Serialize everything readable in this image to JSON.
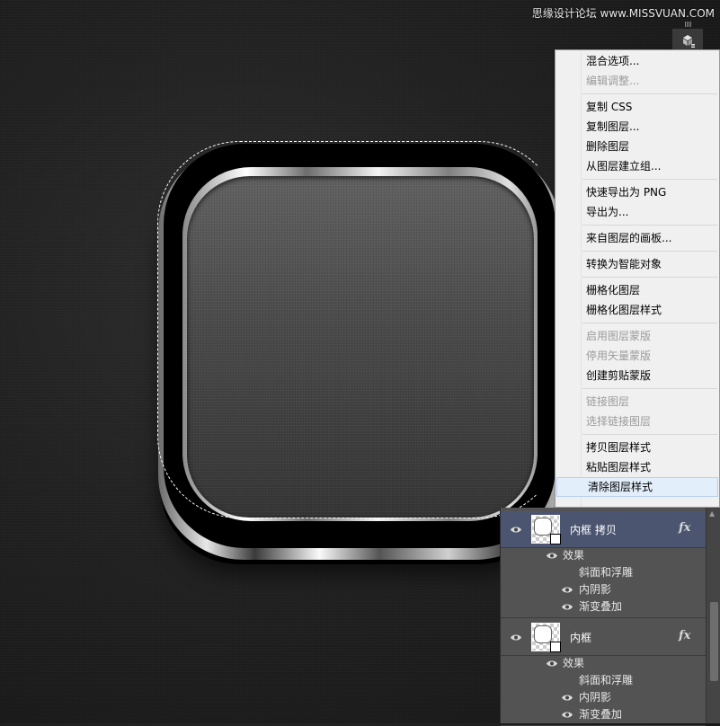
{
  "watermark": "思缘设计论坛 www.MISSVUAN.COM",
  "menu": {
    "groups": [
      [
        {
          "label": "混合选项...",
          "enabled": true
        },
        {
          "label": "编辑调整...",
          "enabled": false
        }
      ],
      [
        {
          "label": "复制 CSS",
          "enabled": true
        },
        {
          "label": "复制图层...",
          "enabled": true
        },
        {
          "label": "删除图层",
          "enabled": true
        },
        {
          "label": "从图层建立组...",
          "enabled": true
        }
      ],
      [
        {
          "label": "快速导出为 PNG",
          "enabled": true
        },
        {
          "label": "导出为...",
          "enabled": true
        }
      ],
      [
        {
          "label": "来自图层的画板...",
          "enabled": true
        }
      ],
      [
        {
          "label": "转换为智能对象",
          "enabled": true
        }
      ],
      [
        {
          "label": "栅格化图层",
          "enabled": true
        },
        {
          "label": "栅格化图层样式",
          "enabled": true
        }
      ],
      [
        {
          "label": "启用图层蒙版",
          "enabled": false
        },
        {
          "label": "停用矢量蒙版",
          "enabled": false
        },
        {
          "label": "创建剪贴蒙版",
          "enabled": true
        }
      ],
      [
        {
          "label": "链接图层",
          "enabled": false
        },
        {
          "label": "选择链接图层",
          "enabled": false
        }
      ],
      [
        {
          "label": "拷贝图层样式",
          "enabled": true
        },
        {
          "label": "粘贴图层样式",
          "enabled": true
        },
        {
          "label": "清除图层样式",
          "enabled": true,
          "hover": true
        }
      ]
    ]
  },
  "layers": [
    {
      "name": "内框 拷贝",
      "selected": true,
      "fx": "fx",
      "effects_label": "效果",
      "effects": [
        "斜面和浮雕",
        "内阴影",
        "渐变叠加"
      ]
    },
    {
      "name": "内框",
      "selected": false,
      "fx": "fx",
      "effects_label": "效果",
      "effects": [
        "斜面和浮雕",
        "内阴影",
        "渐变叠加"
      ]
    }
  ]
}
